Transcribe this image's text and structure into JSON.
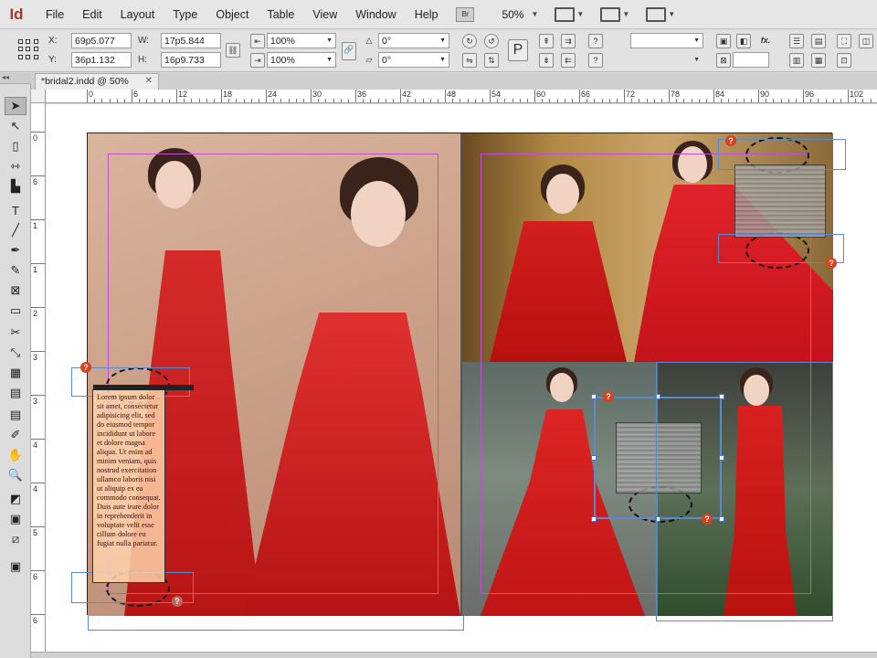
{
  "app": {
    "logo": "Id",
    "bridge_label": "Br",
    "zoom": "50%"
  },
  "menu": [
    "File",
    "Edit",
    "Layout",
    "Type",
    "Object",
    "Table",
    "View",
    "Window",
    "Help"
  ],
  "control": {
    "x_label": "X:",
    "x_value": "69p5.077",
    "y_label": "Y:",
    "y_value": "36p1.132",
    "w_label": "W:",
    "w_value": "17p5.844",
    "h_label": "H:",
    "h_value": "16p9.733",
    "scale_x": "100%",
    "scale_y": "100%",
    "rotate": "0°",
    "shear": "0°",
    "question": "?"
  },
  "document": {
    "tab_title": "*bridal2.indd @ 50%",
    "close": "✕"
  },
  "ruler_h": [
    "0",
    "6",
    "12",
    "18",
    "24",
    "30",
    "36",
    "42",
    "48",
    "54",
    "60",
    "66",
    "72",
    "78",
    "84",
    "90",
    "96",
    "102"
  ],
  "ruler_v": [
    "0",
    "6",
    "1",
    "1",
    "2",
    "3",
    "3",
    "4",
    "4",
    "5",
    "6",
    "6"
  ],
  "textframe": {
    "text": "Lorem ipsum dolor sit amet, consectetur adipisicing elit, sed do eiusmod tempor incididunt ut labore et dolore magna aliqua. Ut enim ad minim veniam, quis nostrud exercitation ullamco laboris nisi ut aliquip ex ea commodo consequat. Duis aute irure dolor in reprehenderit in voluptate velit esse cillum dolore eu fugiat nulla pariatur."
  },
  "badges": {
    "overset": "?"
  },
  "colors": {
    "accent_red": "#d9421f",
    "frame_magenta": "#c050d0",
    "frame_blue": "#5a8ad0"
  }
}
